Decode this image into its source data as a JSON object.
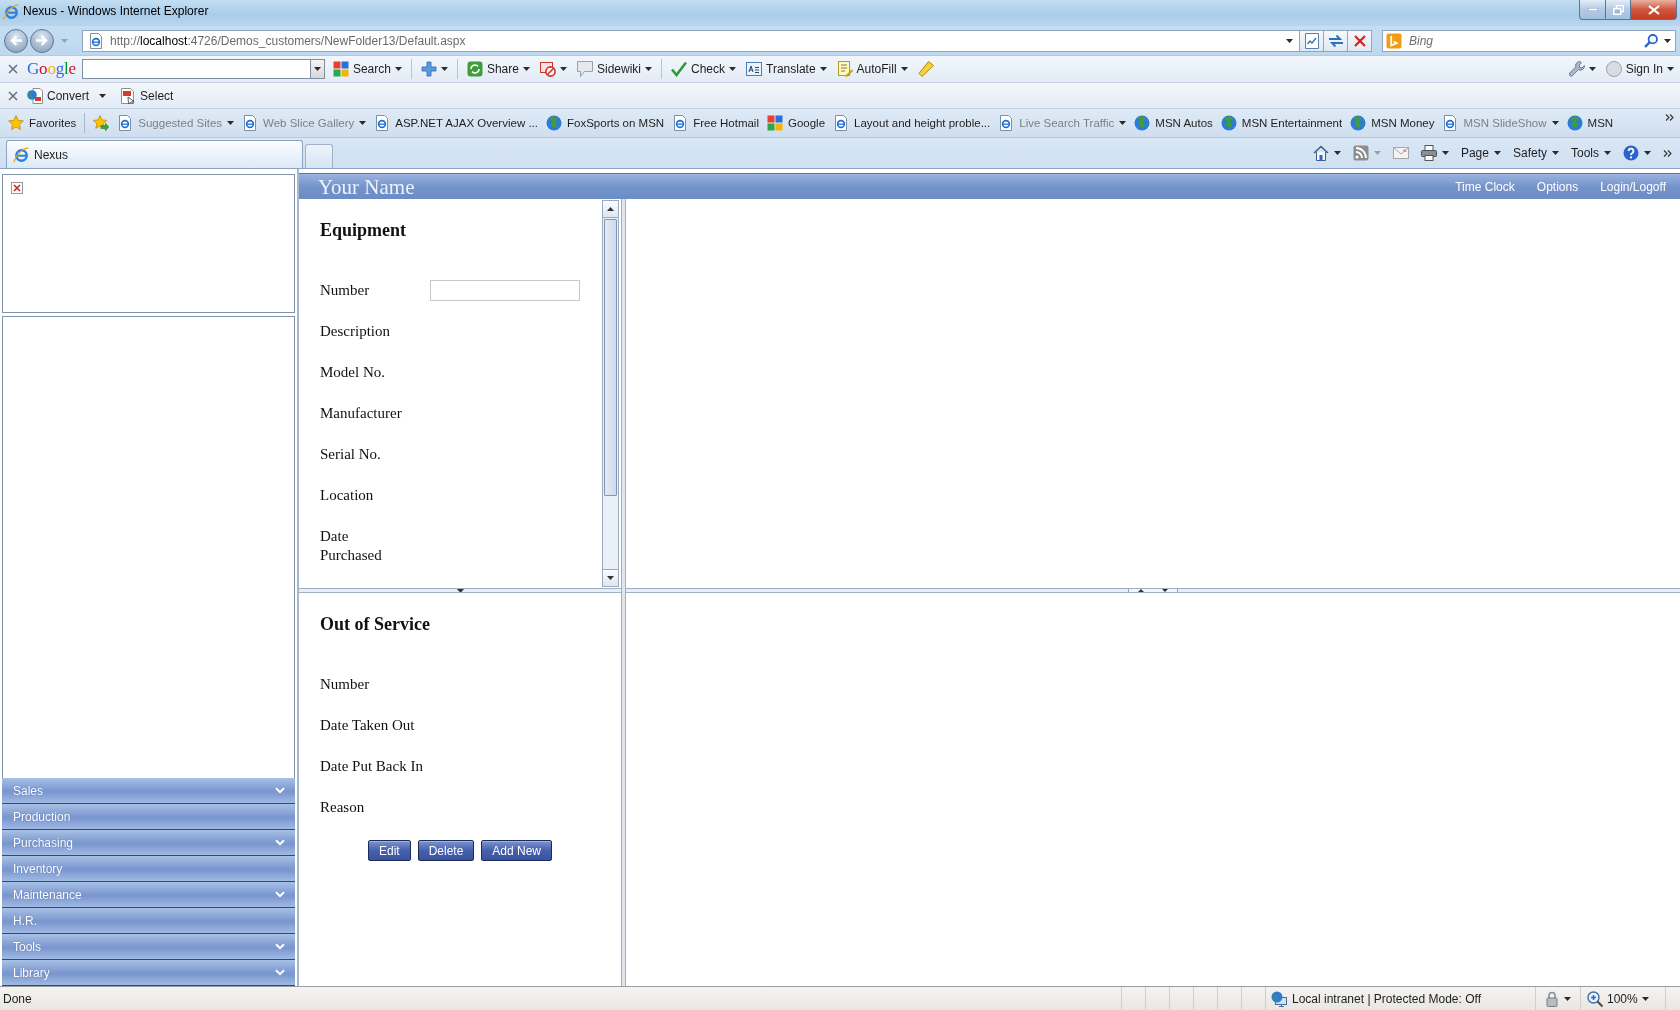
{
  "window": {
    "title": "Nexus - Windows Internet Explorer"
  },
  "address_bar": {
    "url": "http://**localhost**:4726/Demos_customers/NewFolder13/Default.aspx"
  },
  "search_box": {
    "placeholder": "Bing"
  },
  "google_toolbar": {
    "logo": "Google",
    "groups": [
      [
        {
          "kind": "search",
          "label": "Search",
          "menu": true
        }
      ],
      [
        {
          "kind": "plus",
          "menu": true
        }
      ],
      [
        {
          "kind": "share",
          "label": "Share",
          "menu": true
        },
        {
          "kind": "blocker",
          "menu": true
        },
        {
          "kind": "sidewiki",
          "label": "Sidewiki",
          "menu": true
        }
      ],
      [
        {
          "kind": "check",
          "label": "Check",
          "menu": true
        },
        {
          "kind": "translate",
          "label": "Translate",
          "menu": true
        },
        {
          "kind": "autofill",
          "label": "AutoFill",
          "menu": true
        },
        {
          "kind": "highlight",
          "menu": false
        }
      ]
    ],
    "tools": [
      {
        "kind": "wrench",
        "menu": true
      },
      {
        "kind": "signin",
        "label": "Sign In",
        "menu": true
      }
    ]
  },
  "convert_toolbar": {
    "buttons": [
      {
        "kind": "convert",
        "label": "Convert",
        "menu": true
      },
      {
        "kind": "select",
        "label": "Select",
        "menu": false
      }
    ]
  },
  "favorites_bar": {
    "label": "Favorites",
    "items": [
      {
        "kind": "page",
        "label": "Suggested Sites",
        "menu": true,
        "greyed": true
      },
      {
        "kind": "page",
        "label": "Web Slice Gallery",
        "menu": true,
        "greyed": true
      },
      {
        "kind": "page",
        "label": "ASP.NET AJAX Overview ...",
        "menu": false,
        "greyed": false
      },
      {
        "kind": "globe",
        "label": "FoxSports on MSN",
        "menu": false,
        "greyed": false
      },
      {
        "kind": "page",
        "label": "Free Hotmail",
        "menu": false,
        "greyed": false
      },
      {
        "kind": "google",
        "label": "Google",
        "menu": false,
        "greyed": false
      },
      {
        "kind": "page",
        "label": "Layout and height proble...",
        "menu": false,
        "greyed": false
      },
      {
        "kind": "page",
        "label": "Live Search Traffic",
        "menu": true,
        "greyed": true
      },
      {
        "kind": "globe",
        "label": "MSN Autos",
        "menu": false,
        "greyed": false
      },
      {
        "kind": "globe",
        "label": "MSN Entertainment",
        "menu": false,
        "greyed": false
      },
      {
        "kind": "globe",
        "label": "MSN Money",
        "menu": false,
        "greyed": false
      },
      {
        "kind": "page",
        "label": "MSN SlideShow",
        "menu": true,
        "greyed": true
      },
      {
        "kind": "globe",
        "label": "MSN",
        "menu": false,
        "greyed": false
      }
    ]
  },
  "tabs": [
    {
      "label": "Nexus",
      "selected": true
    }
  ],
  "command_bar": [
    {
      "kind": "home",
      "menu": true
    },
    {
      "kind": "feed",
      "menu": true
    },
    {
      "kind": "mail",
      "menu": false
    },
    {
      "kind": "print",
      "menu": true
    },
    {
      "kind": "text",
      "label": "Page",
      "menu": true
    },
    {
      "kind": "text",
      "label": "Safety",
      "menu": true
    },
    {
      "kind": "text",
      "label": "Tools",
      "menu": true
    },
    {
      "kind": "help",
      "menu": true
    }
  ],
  "header": {
    "title": "Your Name",
    "links": [
      "Time Clock",
      "Options",
      "Login/Logoff"
    ]
  },
  "sidebar": {
    "items": [
      {
        "label": "Sales",
        "expandable": true
      },
      {
        "label": "Production",
        "expandable": false
      },
      {
        "label": "Purchasing",
        "expandable": true
      },
      {
        "label": "Inventory",
        "expandable": false
      },
      {
        "label": "Maintenance",
        "expandable": true
      },
      {
        "label": "H.R.",
        "expandable": false
      },
      {
        "label": "Tools",
        "expandable": true
      },
      {
        "label": "Library",
        "expandable": true
      }
    ]
  },
  "equipment_form": {
    "title": "Equipment",
    "fields": [
      {
        "label": "Number",
        "kind": "input"
      },
      {
        "label": "Description",
        "kind": "label"
      },
      {
        "label": "Model No.",
        "kind": "label"
      },
      {
        "label": "Manufacturer",
        "kind": "label"
      },
      {
        "label": "Serial No.",
        "kind": "label"
      },
      {
        "label": "Location",
        "kind": "label"
      },
      {
        "label": "Date Purchased",
        "kind": "label"
      }
    ]
  },
  "out_of_service_form": {
    "title": "Out of Service",
    "fields": [
      {
        "label": "Number",
        "kind": "label"
      },
      {
        "label": "Date Taken Out",
        "kind": "label"
      },
      {
        "label": "Date Put Back In",
        "kind": "label"
      },
      {
        "label": "Reason",
        "kind": "label"
      }
    ],
    "buttons": [
      "Edit",
      "Delete",
      "Add New"
    ]
  },
  "status_bar": {
    "text": "Done",
    "zone": "Local intranet | Protected Mode: Off",
    "zoom": "100%"
  }
}
